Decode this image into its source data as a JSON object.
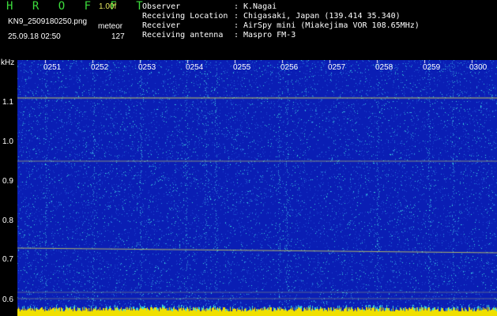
{
  "header": {
    "app_name": "H R O F F T",
    "version": "1.00f",
    "filename": "KN9_2509180250.png",
    "mode": "meteor",
    "datetime": "25.09.18 02:50",
    "count": "127"
  },
  "meta": [
    {
      "label": "Observer",
      "value": "K.Nagai"
    },
    {
      "label": "Receiving Location",
      "value": "Chigasaki, Japan (139.414 35.340)"
    },
    {
      "label": "Receiver",
      "value": "AirSpy mini (Miakejima VOR 108.65MHz)"
    },
    {
      "label": "Receiving antenna",
      "value": "Maspro FM-3"
    }
  ],
  "meta_sep": ":",
  "spectrogram": {
    "y_unit": "kHz",
    "y_ticks": [
      "1.1",
      "1.0",
      "0.9",
      "0.8",
      "0.7",
      "0.6"
    ],
    "time_labels": [
      "0251",
      "0252",
      "0253",
      "0254",
      "0255",
      "0256",
      "0257",
      "0258",
      "0259",
      "0300"
    ],
    "colors": {
      "background": "#0a1eb4",
      "noise": "#3cdcdc",
      "signal": "#e8e850",
      "baseline": "#f0e000"
    }
  }
}
